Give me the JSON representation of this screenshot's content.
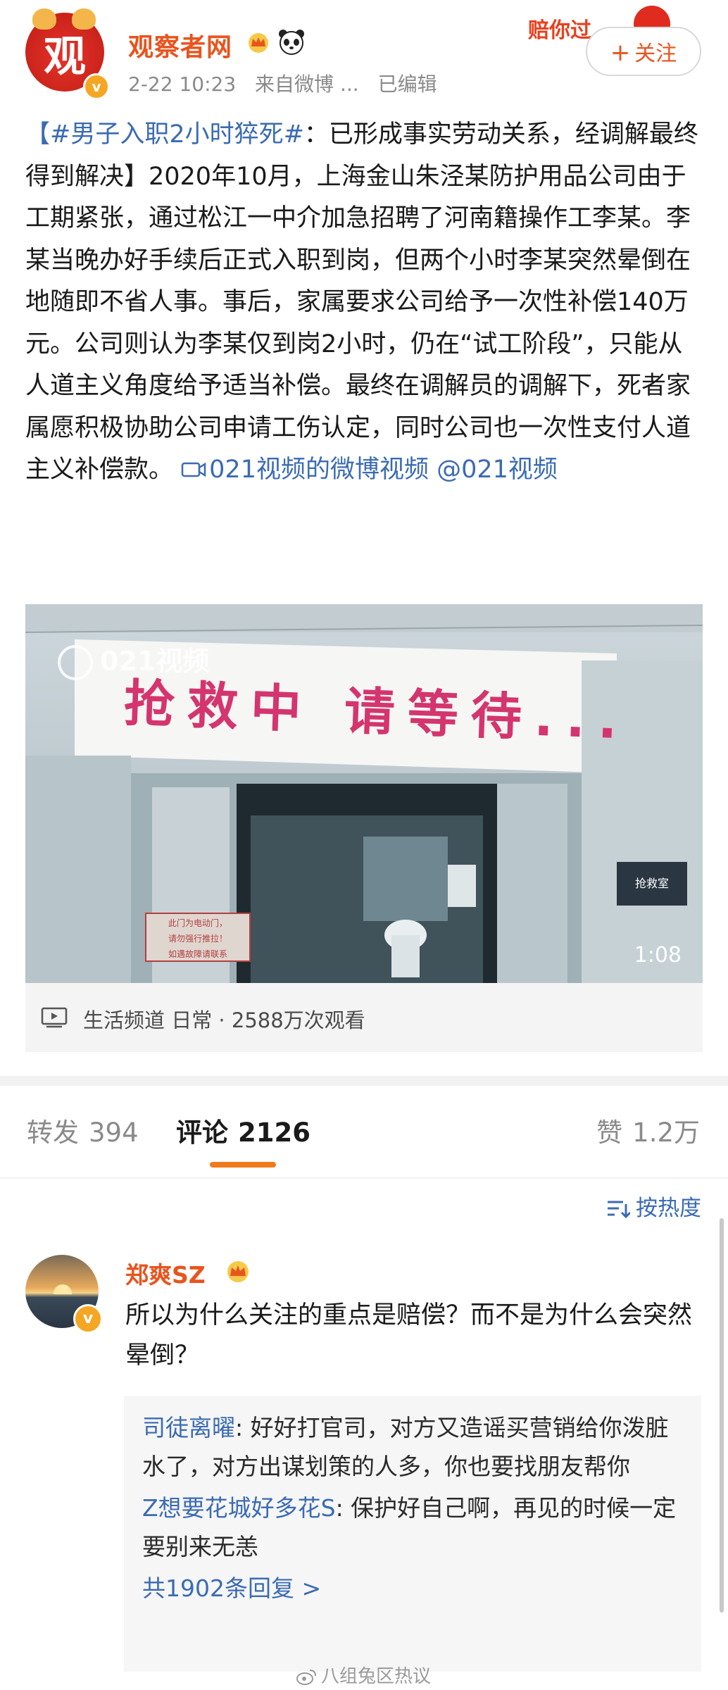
{
  "post": {
    "author": "观察者网",
    "date": "2-22 10:23",
    "source": "来自微博 ...",
    "edited": "已编辑",
    "follow_label": "关注",
    "follow_plus": "+",
    "banner_text": "赔你过",
    "avatar_glyph": "观",
    "body": {
      "hashtag": "【#男子入职2小时猝死#",
      "text": "：已形成事实劳动关系，经调解最终得到解决】2020年10月，上海金山朱泾某防护用品公司由于工期紧张，通过松江一中介加急招聘了河南籍操作工李某。李某当晚办好手续后正式入职到岗，但两个小时李某突然晕倒在地随即不省人事。事后，家属要求公司给予一次性补偿140万元。公司则认为李某仅到岗2小时，仍在“试工阶段”，只能从人道主义角度给予适当补偿。最终在调解员的调解下，死者家属愿积极协助公司申请工伤认定，同时公司也一次性支付人道主义补偿款。",
      "video_link": "021视频的微博视频",
      "mention": "@021视频"
    }
  },
  "video": {
    "sign_text": "抢救中 请等待...",
    "watermark": "021视频",
    "duration": "1:08",
    "room_sign": "抢救室",
    "notice_lines": [
      "此门为电动门，",
      "请勿强行推拉！",
      "如遇故障请联系"
    ],
    "info": "生活频道 日常 · 2588万次观看"
  },
  "tabs": {
    "repost_label": "转发",
    "repost_count": "394",
    "comments_label": "评论",
    "comments_count": "2126",
    "likes_label": "赞",
    "likes_count": "1.2万"
  },
  "sort_label": "按热度",
  "comment": {
    "name": "郑爽SZ",
    "text": "所以为什么关注的重点是赔偿？而不是为什么会突然晕倒？",
    "replies": [
      {
        "name": "司徒离曜",
        "text": "好好打官司，对方又造谣买营销给你泼脏水了，对方出谋划策的人多，你也要找朋友帮你"
      },
      {
        "name": "Z想要花城好多花S",
        "text": "保护好自己啊，再见的时候一定要别来无恙"
      }
    ],
    "more_replies": "共1902条回复 >"
  },
  "watermark": "八组兔区热议",
  "colors": {
    "accent_orange": "#e8541e",
    "link_blue": "#3b6bb3",
    "tab_indicator": "#f07a1a"
  }
}
